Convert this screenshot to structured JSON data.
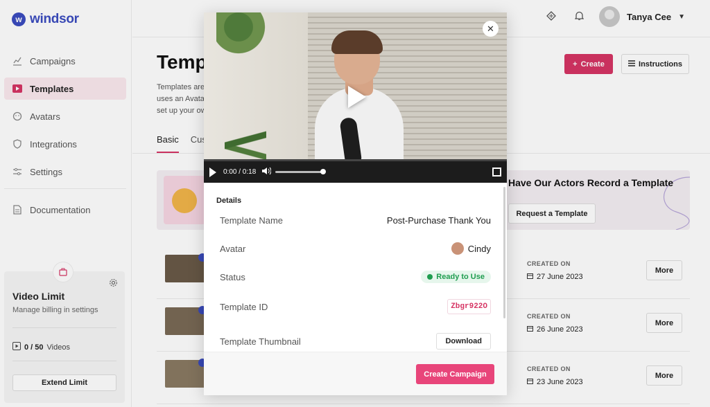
{
  "app": {
    "name": "windsor",
    "logo_letter": "w"
  },
  "sidebar": {
    "items": [
      {
        "label": "Campaigns",
        "icon": "chart-line-icon"
      },
      {
        "label": "Templates",
        "icon": "video-play-icon",
        "active": true
      },
      {
        "label": "Avatars",
        "icon": "face-icon"
      },
      {
        "label": "Integrations",
        "icon": "shield-icon"
      },
      {
        "label": "Settings",
        "icon": "sliders-icon"
      },
      {
        "label": "Documentation",
        "icon": "document-icon"
      }
    ],
    "limit": {
      "title": "Video Limit",
      "subtitle": "Manage billing in settings",
      "used": "0 / 50",
      "unit": "Videos",
      "extend_label": "Extend Limit"
    }
  },
  "header": {
    "user_name": "Tanya Cee"
  },
  "main": {
    "title": "Templ",
    "description_lines": [
      "Templates are",
      "uses an Avata",
      "set up your ow"
    ],
    "create_label": "Create",
    "instructions_label": "Instructions",
    "tabs": [
      {
        "label": "Basic",
        "active": true
      },
      {
        "label": "Cus"
      }
    ],
    "promo": {
      "title": "Have Our Actors Record a Template",
      "button_label": "Request a Template"
    },
    "rows": [
      {
        "created_label": "CREATED ON",
        "date": "27 June 2023",
        "more_label": "More"
      },
      {
        "created_label": "CREATED ON",
        "date": "26 June 2023",
        "more_label": "More"
      },
      {
        "created_label": "CREATED ON",
        "date": "23 June 2023",
        "more_label": "More"
      }
    ]
  },
  "modal": {
    "video": {
      "time": "0:00 / 0:18",
      "volume": 0.95
    },
    "details_heading": "Details",
    "fields": {
      "name_label": "Template Name",
      "name_value": "Post-Purchase Thank You",
      "avatar_label": "Avatar",
      "avatar_value": "Cindy",
      "status_label": "Status",
      "status_value": "Ready to Use",
      "id_label": "Template ID",
      "id_value": "Zbgr922O",
      "thumb_label": "Template Thumbnail",
      "download_label": "Download"
    },
    "create_campaign_label": "Create Campaign"
  },
  "colors": {
    "accent": "#d63564",
    "brand": "#3b4cc0",
    "success": "#1f9d4f"
  }
}
